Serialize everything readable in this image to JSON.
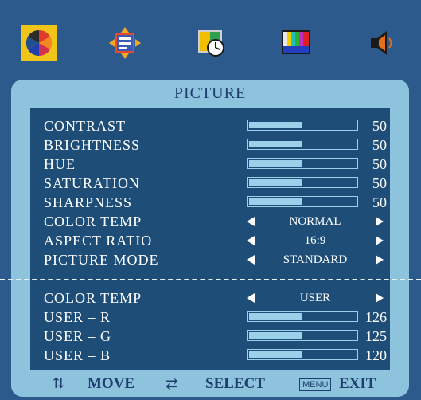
{
  "panel": {
    "title": "PICTURE"
  },
  "tabs": [
    {
      "icon": "color-wheel-icon",
      "active": true
    },
    {
      "icon": "osd-position-icon",
      "active": false
    },
    {
      "icon": "timer-clock-icon",
      "active": false
    },
    {
      "icon": "color-bars-icon",
      "active": false
    },
    {
      "icon": "speaker-icon",
      "active": false
    }
  ],
  "settings": [
    {
      "label": "CONTRAST",
      "value": "50",
      "level": 0.5
    },
    {
      "label": "BRIGHTNESS",
      "value": "50",
      "level": 0.5
    },
    {
      "label": "HUE",
      "value": "50",
      "level": 0.5
    },
    {
      "label": "SATURATION",
      "value": "50",
      "level": 0.5
    },
    {
      "label": "SHARPNESS",
      "value": "50",
      "level": 0.5
    }
  ],
  "options": [
    {
      "label": "COLOR TEMP",
      "value": "NORMAL"
    },
    {
      "label": "ASPECT RATIO",
      "value": "16:9"
    },
    {
      "label": "PICTURE MODE",
      "value": "STANDARD"
    }
  ],
  "user_color": {
    "color_temp": {
      "label": "COLOR TEMP",
      "value": "USER"
    },
    "channels": [
      {
        "label": "USER – R",
        "value": "126",
        "level": 0.5
      },
      {
        "label": "USER – G",
        "value": "125",
        "level": 0.5
      },
      {
        "label": "USER – B",
        "value": "120",
        "level": 0.5
      }
    ]
  },
  "footer": {
    "move": "MOVE",
    "select": "SELECT",
    "menu_key": "MENU",
    "exit": "EXIT"
  },
  "colors": {
    "accent": "#f0c418",
    "panel": "#8ec3de",
    "inner": "#1e4e77",
    "background": "#2d5a8c"
  }
}
